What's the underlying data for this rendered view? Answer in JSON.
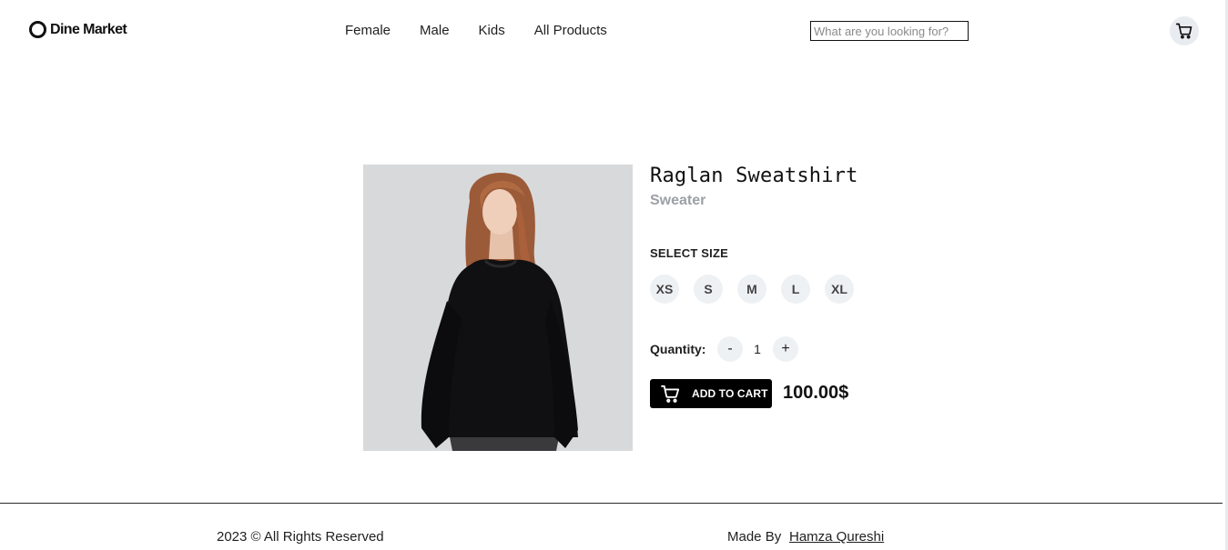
{
  "header": {
    "logo_text": "Dine Market",
    "nav": [
      "Female",
      "Male",
      "Kids",
      "All Products"
    ],
    "search_placeholder": "What are you looking for?"
  },
  "product": {
    "title": "Raglan Sweatshirt",
    "subtitle": "Sweater",
    "select_size_label": "SELECT SIZE",
    "sizes": [
      "XS",
      "S",
      "M",
      "L",
      "XL"
    ],
    "quantity_label": "Quantity:",
    "quantity_minus": "-",
    "quantity_value": "1",
    "quantity_plus": "+",
    "add_to_cart_label": "ADD TO CART",
    "price": "100.00$"
  },
  "footer": {
    "copyright": "2023 © All Rights Reserved",
    "made_by_label": "Made By",
    "author": "Hamza Qureshi"
  },
  "icons": {
    "header_cart": "cart-icon",
    "button_cart": "cart-icon",
    "logo": "logo-ring-icon"
  },
  "colors": {
    "accent": "#000000",
    "image_background": "#d8d9db",
    "chip_background": "#eef1f4",
    "subtitle_gray": "#9ca0a6"
  }
}
